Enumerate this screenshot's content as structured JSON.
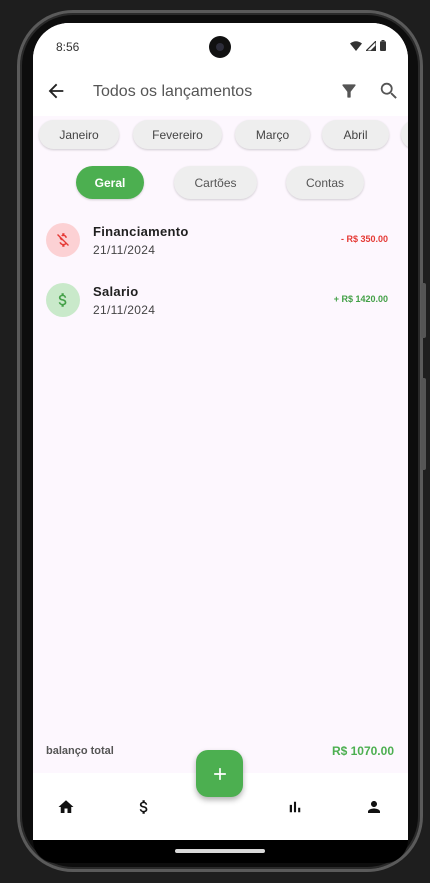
{
  "status_bar": {
    "time": "8:56"
  },
  "app_bar": {
    "title": "Todos os lançamentos"
  },
  "months": [
    {
      "label": "Janeiro"
    },
    {
      "label": "Fevereiro"
    },
    {
      "label": "Março"
    },
    {
      "label": "Abril"
    },
    {
      "label": ""
    }
  ],
  "tabs": [
    {
      "label": "Geral",
      "active": true
    },
    {
      "label": "Cartões",
      "active": false
    },
    {
      "label": "Contas",
      "active": false
    }
  ],
  "transactions": [
    {
      "name": "Financiamento",
      "date": "21/11/2024",
      "amount": "- R$ 350.00",
      "type": "expense",
      "icon": "money-off-icon"
    },
    {
      "name": "Salario",
      "date": "21/11/2024",
      "amount": "+ R$ 1420.00",
      "type": "income",
      "icon": "dollar-icon"
    }
  ],
  "balance": {
    "label": "balanço total",
    "value": "R$ 1070.00"
  },
  "bottom_nav": [
    {
      "icon": "home-icon"
    },
    {
      "icon": "dollar-icon"
    },
    {
      "icon": "bar-chart-icon"
    },
    {
      "icon": "person-icon"
    }
  ],
  "colors": {
    "accent": "#4caf50",
    "expense": "#e53935",
    "income": "#43a047",
    "background": "#fdf7fe"
  }
}
